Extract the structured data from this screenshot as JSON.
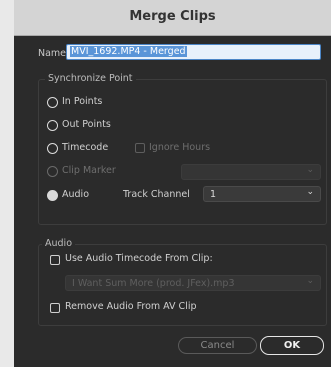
{
  "dialog": {
    "title": "Merge Clips"
  },
  "name_field": {
    "label": "Name:",
    "value": "MVI_1692.MP4 - Merged"
  },
  "sync": {
    "legend": "Synchronize Point",
    "options": [
      {
        "label": "In Points",
        "selected": false,
        "enabled": true
      },
      {
        "label": "Out Points",
        "selected": false,
        "enabled": true
      },
      {
        "label": "Timecode",
        "selected": false,
        "enabled": true
      },
      {
        "label": "Clip Marker",
        "selected": false,
        "enabled": false
      },
      {
        "label": "Audio",
        "selected": true,
        "enabled": true
      }
    ],
    "ignore_hours": {
      "label": "Ignore Hours",
      "checked": false,
      "enabled": false
    },
    "track_channel": {
      "label": "Track Channel",
      "value": "1"
    }
  },
  "audio": {
    "legend": "Audio",
    "use_timecode": {
      "label": "Use Audio Timecode From Clip:",
      "checked": false
    },
    "clip_select": {
      "value": "I Want Sum More (prod. JFex).mp3",
      "enabled": false
    },
    "remove_audio": {
      "label": "Remove Audio From AV Clip",
      "checked": false
    }
  },
  "buttons": {
    "cancel": "Cancel",
    "ok": "OK"
  },
  "icons": {
    "dropdown": "chevron-down-icon"
  }
}
